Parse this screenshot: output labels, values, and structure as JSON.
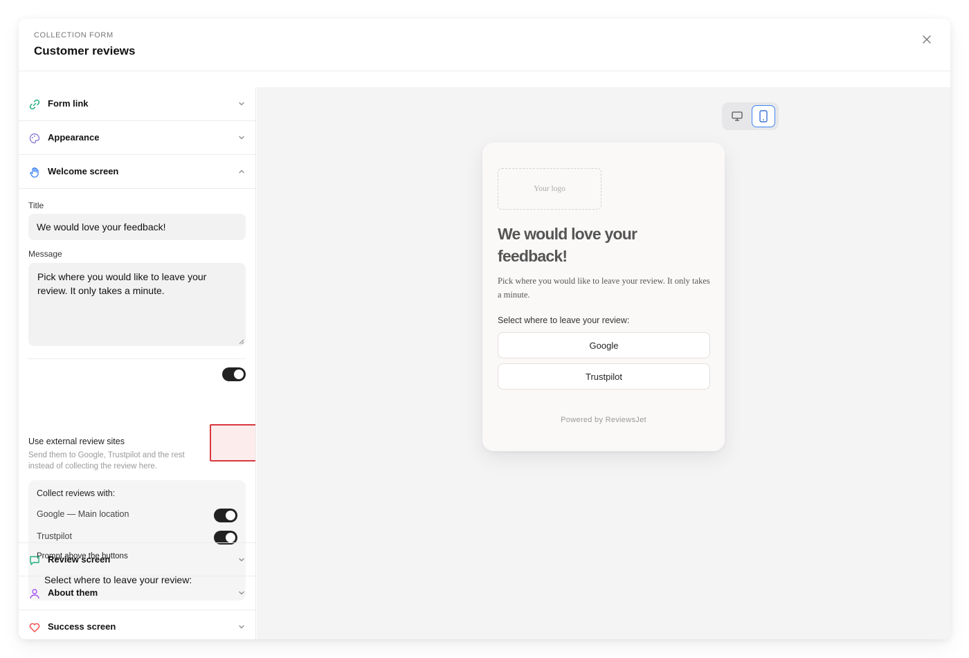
{
  "header": {
    "eyebrow": "COLLECTION FORM",
    "title": "Customer reviews",
    "close_icon": "close-icon"
  },
  "sidebar": {
    "sections": {
      "form_link": {
        "label": "Form link",
        "icon": "link-icon",
        "icon_color": "#22b07d"
      },
      "appearance": {
        "label": "Appearance",
        "icon": "palette-icon",
        "icon_color": "#8b7fd4"
      },
      "welcome": {
        "label": "Welcome screen",
        "icon": "hand-icon",
        "icon_color": "#3b82f6",
        "expanded": true
      },
      "review": {
        "label": "Review screen",
        "icon": "chat-icon",
        "icon_color": "#22b07d"
      },
      "about": {
        "label": "About them",
        "icon": "user-icon",
        "icon_color": "#a855f7"
      },
      "success": {
        "label": "Success screen",
        "icon": "heart-icon",
        "icon_color": "#ef4444"
      }
    },
    "welcome_form": {
      "title_label": "Title",
      "title_value": "We would love your feedback!",
      "message_label": "Message",
      "message_value": "Pick where you would like to leave your review. It only takes a minute.",
      "external": {
        "title": "Use external review sites",
        "subtitle": "Send them to Google, Trustpilot and the rest instead of collecting the review here.",
        "enabled": true
      },
      "collect": {
        "heading": "Collect reviews with:",
        "items": [
          {
            "label": "Google — Main location",
            "enabled": true
          },
          {
            "label": "Trustpilot",
            "enabled": true
          }
        ],
        "prompt_label": "Prompt above the buttons",
        "prompt_value": "Select where to leave your review:"
      }
    }
  },
  "preview": {
    "view_modes": {
      "desktop_icon": "monitor-icon",
      "mobile_icon": "phone-icon",
      "selected": "mobile"
    },
    "logo_placeholder": "Your logo",
    "title": "We would love your feedback!",
    "message": "Pick where you would like to leave your review. It only takes a minute.",
    "prompt": "Select where to leave your review:",
    "buttons": [
      "Google",
      "Trustpilot"
    ],
    "powered_by": "Powered by ReviewsJet"
  }
}
